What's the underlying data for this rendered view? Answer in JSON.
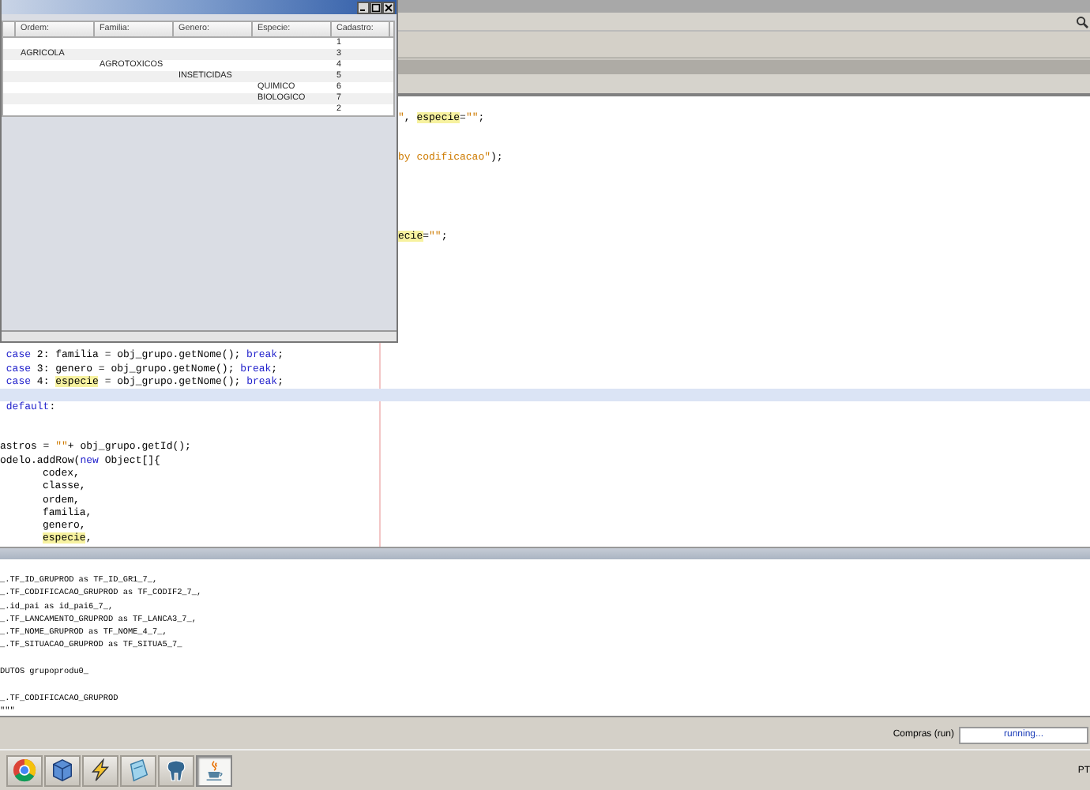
{
  "dialog": {
    "table": {
      "columns": [
        "Ordem:",
        "Familia:",
        "Genero:",
        "Especie:",
        "Cadastro:"
      ],
      "rows": [
        {
          "cadastro": "1"
        },
        {
          "ordem": "AGRICOLA",
          "cadastro": "3"
        },
        {
          "familia": "AGROTOXICOS",
          "cadastro": "4"
        },
        {
          "genero": "INSETICIDAS",
          "cadastro": "5"
        },
        {
          "especie": "QUIMICO",
          "cadastro": "6"
        },
        {
          "especie": "BIOLOGICO",
          "cadastro": "7"
        },
        {
          "cadastro": "2"
        }
      ]
    }
  },
  "editor": {
    "upper_lines": [
      {
        "current": false
      },
      {
        "current": false,
        "tokens": [
          {
            "text": "\"",
            "kind": "string"
          },
          {
            "text": ", ",
            "kind": "plain"
          },
          {
            "text": "especie",
            "kind": "mark"
          },
          {
            "text": "=",
            "kind": "plain"
          },
          {
            "text": "\"\"",
            "kind": "string"
          },
          {
            "text": ";",
            "kind": "plain"
          }
        ]
      },
      {
        "current": false
      },
      {
        "current": false
      },
      {
        "current": false,
        "tokens": [
          {
            "text": "by codificacao\"",
            "kind": "string"
          },
          {
            "text": ");",
            "kind": "plain"
          }
        ]
      },
      {
        "current": false
      },
      {
        "current": false
      },
      {
        "current": false
      },
      {
        "current": false
      },
      {
        "current": false
      },
      {
        "current": false,
        "tokens": [
          {
            "text": "ecie",
            "kind": "mark"
          },
          {
            "text": "=",
            "kind": "plain"
          },
          {
            "text": "\"\"",
            "kind": "string"
          },
          {
            "text": ";",
            "kind": "plain"
          }
        ]
      }
    ],
    "lines": [
      {
        "current": false
      },
      {
        "current": false,
        "indented": false,
        "tokens": [
          {
            "text": " case",
            "kind": "keyword"
          },
          {
            "text": " 2: familia = obj_grupo.getNome(); ",
            "kind": "plain"
          },
          {
            "text": "break",
            "kind": "keyword"
          },
          {
            "text": ";",
            "kind": "plain"
          }
        ]
      },
      {
        "current": false,
        "indented": false,
        "tokens": [
          {
            "text": " case",
            "kind": "keyword"
          },
          {
            "text": " 3: genero = obj_grupo.getNome(); ",
            "kind": "plain"
          },
          {
            "text": "break",
            "kind": "keyword"
          },
          {
            "text": ";",
            "kind": "plain"
          }
        ]
      },
      {
        "current": false,
        "indented": false,
        "tokens": [
          {
            "text": " case",
            "kind": "keyword"
          },
          {
            "text": " 4: ",
            "kind": "plain"
          },
          {
            "text": "especie",
            "kind": "mark"
          },
          {
            "text": " = obj_grupo.getNome(); ",
            "kind": "plain"
          },
          {
            "text": "break",
            "kind": "keyword"
          },
          {
            "text": ";",
            "kind": "plain"
          }
        ]
      },
      {
        "current": true
      },
      {
        "current": false,
        "indented": false,
        "tokens": [
          {
            "text": " default",
            "kind": "keyword"
          },
          {
            "text": ":",
            "kind": "plain"
          }
        ]
      },
      {
        "current": false
      },
      {
        "current": false
      },
      {
        "current": false,
        "indented": false,
        "tokens": [
          {
            "text": "astros = ",
            "kind": "plain"
          },
          {
            "text": "\"\"",
            "kind": "string"
          },
          {
            "text": "+ obj_grupo.getId();",
            "kind": "plain"
          }
        ]
      },
      {
        "current": false,
        "indented": false,
        "tokens": [
          {
            "text": "odelo.addRow(",
            "kind": "plain"
          },
          {
            "text": "new",
            "kind": "keyword"
          },
          {
            "text": " Object[]{",
            "kind": "plain"
          }
        ]
      },
      {
        "current": false,
        "indented": true,
        "tokens": [
          {
            "text": "codex,",
            "kind": "plain"
          }
        ]
      },
      {
        "current": false,
        "indented": true,
        "tokens": [
          {
            "text": "classe,",
            "kind": "plain"
          }
        ]
      },
      {
        "current": false,
        "indented": true,
        "tokens": [
          {
            "text": "ordem,",
            "kind": "plain"
          }
        ]
      },
      {
        "current": false,
        "indented": true,
        "tokens": [
          {
            "text": "familia,",
            "kind": "plain"
          }
        ]
      },
      {
        "current": false,
        "indented": true,
        "tokens": [
          {
            "text": "genero,",
            "kind": "plain"
          }
        ]
      },
      {
        "current": false,
        "indented": true,
        "tokens": [
          {
            "text": "especie",
            "kind": "mark"
          },
          {
            "text": ",",
            "kind": "plain"
          }
        ]
      }
    ]
  },
  "output": {
    "lines": [
      {
        "text": "_.TF_ID_GRUPROD as TF_ID_GR1_7_,",
        "gap_before": false
      },
      {
        "text": "_.TF_CODIFICACAO_GRUPROD as TF_CODIF2_7_,",
        "gap_before": false
      },
      {
        "text": "_.id_pai as id_pai6_7_,",
        "gap_before": false
      },
      {
        "text": "_.TF_LANCAMENTO_GRUPROD as TF_LANCA3_7_,",
        "gap_before": false
      },
      {
        "text": "_.TF_NOME_GRUPROD as TF_NOME_4_7_,",
        "gap_before": false
      },
      {
        "text": "_.TF_SITUACAO_GRUPROD as TF_SITUA5_7_",
        "gap_before": false
      },
      {
        "text": "DUTOS grupoprodu0_",
        "gap_before": true
      },
      {
        "text": "_.TF_CODIFICACAO_GRUPROD",
        "gap_before": true
      },
      {
        "text": "\"\"\"",
        "gap_before": false
      }
    ]
  },
  "status_bar": {
    "task": "Compras (run)",
    "progress": "running..."
  },
  "taskbar": {
    "buttons": [
      {
        "selected": false
      },
      {
        "selected": false
      },
      {
        "selected": false
      },
      {
        "selected": false
      },
      {
        "selected": false
      },
      {
        "selected": true
      }
    ],
    "language": "PT"
  }
}
